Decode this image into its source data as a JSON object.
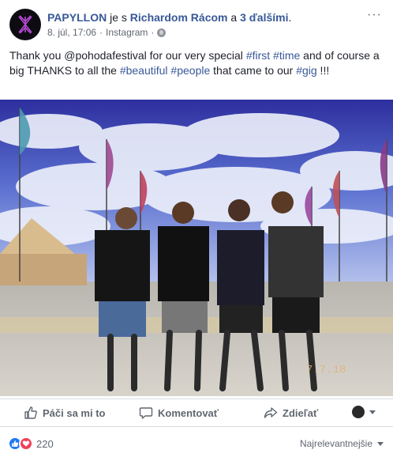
{
  "header": {
    "page_name": "PAPYLLON",
    "with_text": " je s ",
    "tagged_person": "Richardom Rácom",
    "and_text": " a ",
    "others": "3 ďalšími",
    "end_punct": ".",
    "date": "8. júl, 17:06",
    "separator": "·",
    "source": "Instagram",
    "separator2": "·",
    "more_label": "···"
  },
  "post": {
    "text_1": "Thank you @pohodafestival for our very special ",
    "tag_first": "#first",
    "text_2": " ",
    "tag_time": "#time",
    "text_3": " and of course a big THANKS to all the ",
    "tag_beautiful": "#beautiful",
    "text_4": " ",
    "tag_people": "#people",
    "text_5": " that came to our ",
    "tag_gig": "#gig",
    "text_6": " !!!"
  },
  "photo": {
    "timestamp_overlay": "7.7.18"
  },
  "actions": {
    "like": "Páči sa mi to",
    "comment": "Komentovať",
    "share": "Zdieľať"
  },
  "footer": {
    "reaction_count": "220",
    "sort_label": "Najrelevantnejšie"
  },
  "colors": {
    "link": "#385898",
    "like_blue": "#2078f4",
    "love_red": "#f33e58",
    "muted": "#606770"
  }
}
